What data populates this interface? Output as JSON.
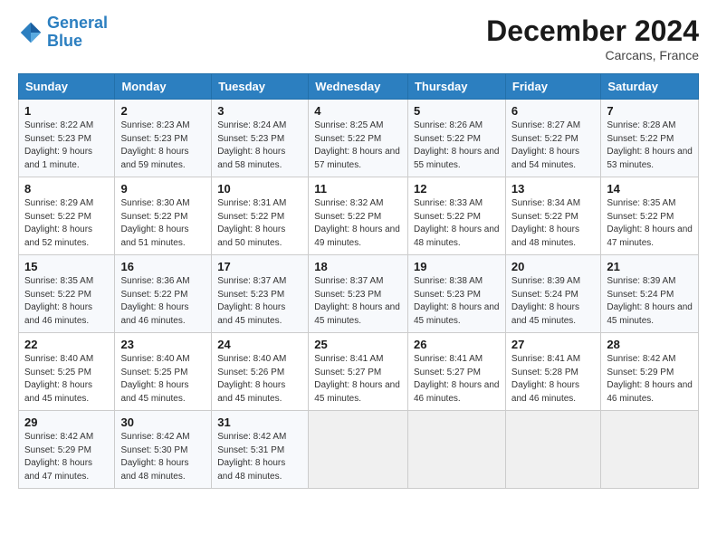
{
  "logo": {
    "line1": "General",
    "line2": "Blue"
  },
  "header": {
    "month": "December 2024",
    "location": "Carcans, France"
  },
  "days_of_week": [
    "Sunday",
    "Monday",
    "Tuesday",
    "Wednesday",
    "Thursday",
    "Friday",
    "Saturday"
  ],
  "weeks": [
    [
      {
        "day": "1",
        "info": "Sunrise: 8:22 AM\nSunset: 5:23 PM\nDaylight: 9 hours and 1 minute."
      },
      {
        "day": "2",
        "info": "Sunrise: 8:23 AM\nSunset: 5:23 PM\nDaylight: 8 hours and 59 minutes."
      },
      {
        "day": "3",
        "info": "Sunrise: 8:24 AM\nSunset: 5:23 PM\nDaylight: 8 hours and 58 minutes."
      },
      {
        "day": "4",
        "info": "Sunrise: 8:25 AM\nSunset: 5:22 PM\nDaylight: 8 hours and 57 minutes."
      },
      {
        "day": "5",
        "info": "Sunrise: 8:26 AM\nSunset: 5:22 PM\nDaylight: 8 hours and 55 minutes."
      },
      {
        "day": "6",
        "info": "Sunrise: 8:27 AM\nSunset: 5:22 PM\nDaylight: 8 hours and 54 minutes."
      },
      {
        "day": "7",
        "info": "Sunrise: 8:28 AM\nSunset: 5:22 PM\nDaylight: 8 hours and 53 minutes."
      }
    ],
    [
      {
        "day": "8",
        "info": "Sunrise: 8:29 AM\nSunset: 5:22 PM\nDaylight: 8 hours and 52 minutes."
      },
      {
        "day": "9",
        "info": "Sunrise: 8:30 AM\nSunset: 5:22 PM\nDaylight: 8 hours and 51 minutes."
      },
      {
        "day": "10",
        "info": "Sunrise: 8:31 AM\nSunset: 5:22 PM\nDaylight: 8 hours and 50 minutes."
      },
      {
        "day": "11",
        "info": "Sunrise: 8:32 AM\nSunset: 5:22 PM\nDaylight: 8 hours and 49 minutes."
      },
      {
        "day": "12",
        "info": "Sunrise: 8:33 AM\nSunset: 5:22 PM\nDaylight: 8 hours and 48 minutes."
      },
      {
        "day": "13",
        "info": "Sunrise: 8:34 AM\nSunset: 5:22 PM\nDaylight: 8 hours and 48 minutes."
      },
      {
        "day": "14",
        "info": "Sunrise: 8:35 AM\nSunset: 5:22 PM\nDaylight: 8 hours and 47 minutes."
      }
    ],
    [
      {
        "day": "15",
        "info": "Sunrise: 8:35 AM\nSunset: 5:22 PM\nDaylight: 8 hours and 46 minutes."
      },
      {
        "day": "16",
        "info": "Sunrise: 8:36 AM\nSunset: 5:22 PM\nDaylight: 8 hours and 46 minutes."
      },
      {
        "day": "17",
        "info": "Sunrise: 8:37 AM\nSunset: 5:23 PM\nDaylight: 8 hours and 45 minutes."
      },
      {
        "day": "18",
        "info": "Sunrise: 8:37 AM\nSunset: 5:23 PM\nDaylight: 8 hours and 45 minutes."
      },
      {
        "day": "19",
        "info": "Sunrise: 8:38 AM\nSunset: 5:23 PM\nDaylight: 8 hours and 45 minutes."
      },
      {
        "day": "20",
        "info": "Sunrise: 8:39 AM\nSunset: 5:24 PM\nDaylight: 8 hours and 45 minutes."
      },
      {
        "day": "21",
        "info": "Sunrise: 8:39 AM\nSunset: 5:24 PM\nDaylight: 8 hours and 45 minutes."
      }
    ],
    [
      {
        "day": "22",
        "info": "Sunrise: 8:40 AM\nSunset: 5:25 PM\nDaylight: 8 hours and 45 minutes."
      },
      {
        "day": "23",
        "info": "Sunrise: 8:40 AM\nSunset: 5:25 PM\nDaylight: 8 hours and 45 minutes."
      },
      {
        "day": "24",
        "info": "Sunrise: 8:40 AM\nSunset: 5:26 PM\nDaylight: 8 hours and 45 minutes."
      },
      {
        "day": "25",
        "info": "Sunrise: 8:41 AM\nSunset: 5:27 PM\nDaylight: 8 hours and 45 minutes."
      },
      {
        "day": "26",
        "info": "Sunrise: 8:41 AM\nSunset: 5:27 PM\nDaylight: 8 hours and 46 minutes."
      },
      {
        "day": "27",
        "info": "Sunrise: 8:41 AM\nSunset: 5:28 PM\nDaylight: 8 hours and 46 minutes."
      },
      {
        "day": "28",
        "info": "Sunrise: 8:42 AM\nSunset: 5:29 PM\nDaylight: 8 hours and 46 minutes."
      }
    ],
    [
      {
        "day": "29",
        "info": "Sunrise: 8:42 AM\nSunset: 5:29 PM\nDaylight: 8 hours and 47 minutes."
      },
      {
        "day": "30",
        "info": "Sunrise: 8:42 AM\nSunset: 5:30 PM\nDaylight: 8 hours and 48 minutes."
      },
      {
        "day": "31",
        "info": "Sunrise: 8:42 AM\nSunset: 5:31 PM\nDaylight: 8 hours and 48 minutes."
      },
      null,
      null,
      null,
      null
    ]
  ]
}
